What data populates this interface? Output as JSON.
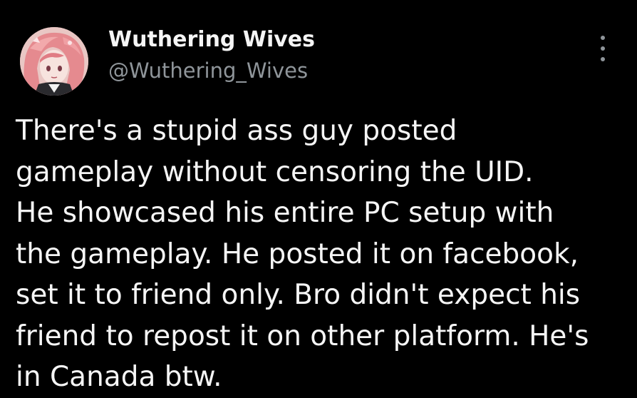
{
  "author": {
    "display_name": "Wuthering Wives",
    "handle": "@Wuthering_Wives",
    "avatar_icon": "anime-character-avatar"
  },
  "more_menu": {
    "icon": "vertical-ellipsis-icon"
  },
  "post": {
    "lines": [
      "There's a stupid ass guy posted",
      "gameplay without censoring the UID.",
      "He showcased his entire PC setup with",
      "the gameplay. He posted it on facebook,",
      "set it to friend only. Bro didn't expect his",
      "friend to repost it on other platform. He's",
      "in Canada btw."
    ]
  },
  "colors": {
    "background": "#000000",
    "text_primary": "#f5f5f5",
    "text_secondary": "#8f959a",
    "avatar_hair": "#e58a8f"
  }
}
